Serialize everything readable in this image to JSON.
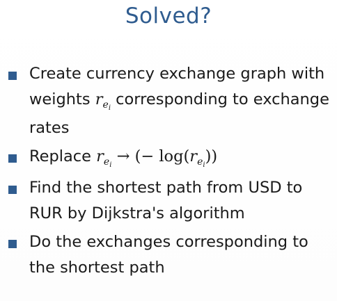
{
  "slide": {
    "title": "Solved?",
    "bullets": [
      {
        "text_before": "Create currency exchange graph with weights ",
        "math_var": "r",
        "math_sub": "e",
        "math_subsub": "i",
        "text_after": " corresponding to exchange rates"
      },
      {
        "text_before": "Replace ",
        "math_var": "r",
        "math_sub": "e",
        "math_subsub": "i",
        "arrow": " → (− log(",
        "math_var2": "r",
        "math_sub2": "e",
        "math_subsub2": "i",
        "text_after": "))"
      },
      {
        "text": "Find the shortest path from USD to RUR by Dijkstra's algorithm"
      },
      {
        "text": "Do the exchanges corresponding to the shortest path"
      }
    ],
    "colors": {
      "accent": "#2f5c8f",
      "text": "#1a1a1a",
      "background": "#ffffff"
    }
  }
}
